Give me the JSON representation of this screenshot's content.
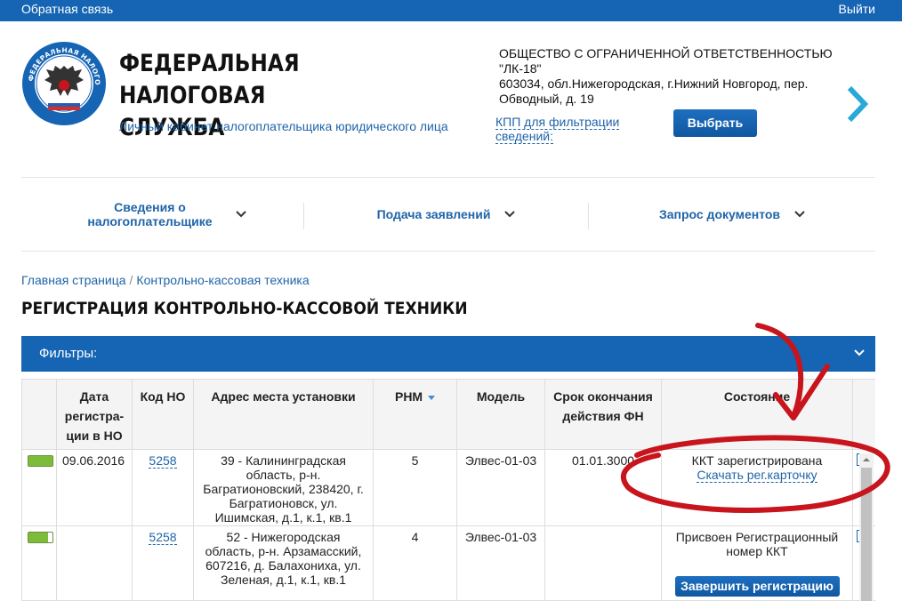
{
  "topbar": {
    "feedback": "Обратная связь",
    "logout": "Выйти"
  },
  "brand": {
    "title_lines": [
      "ФЕДЕРАЛЬНАЯ",
      "НАЛОГОВАЯ СЛУЖБА"
    ],
    "subtitle": "Личный кабинет налогоплательщика юридического лица",
    "emblem_text": "ФЕДЕРАЛЬНАЯ НАЛОГОВАЯ СЛУЖБА"
  },
  "org": {
    "lines": [
      "ОБЩЕСТВО С ОГРАНИЧЕННОЙ ОТВЕТСТВЕННОСТЬЮ",
      "\"ЛК-18\"",
      "603034, обл.Нижегородская, г.Нижний Новгород, пер.",
      "Обводный, д. 19"
    ],
    "kpp_link": "КПП для фильтрации сведений:",
    "choose_button": "Выбрать"
  },
  "nav": {
    "items": [
      {
        "label": "Сведения о налогоплательщике"
      },
      {
        "label": "Подача заявлений"
      },
      {
        "label": "Запрос документов"
      }
    ]
  },
  "breadcrumb": {
    "home": "Главная страница",
    "separator": "/",
    "current": "Контрольно-кассовая техника"
  },
  "page_title": "РЕГИСТРАЦИЯ КОНТРОЛЬНО-КАССОВОЙ ТЕХНИКИ",
  "filters": {
    "label": "Фильтры:"
  },
  "table": {
    "headers": {
      "date": "Дата регистра- ции в НО",
      "code": "Код НО",
      "address": "Адрес места установки",
      "rnm": "РНМ",
      "model": "Модель",
      "fn_expiry": "Срок окончания действия ФН",
      "status": "Состояние"
    },
    "rows": [
      {
        "progress": 1.0,
        "date": "09.06.2016",
        "code": "5258",
        "address": "39 - Калининградская область, р-н. Багратионовский, 238420, г. Багратионовск, ул. Ишимская, д.1, к.1, кв.1",
        "rnm": "5",
        "model": "Элвес-01-03",
        "fn_expiry": "01.01.3000",
        "status": "ККТ зарегистрирована",
        "status_link": "Скачать рег.карточку"
      },
      {
        "progress": 0.8,
        "date": "",
        "code": "5258",
        "address": "52 - Нижегородская область, р-н. Арзамасский, 607216, д. Балахониха, ул. Зеленая, д.1, к.1, кв.1",
        "rnm": "4",
        "model": "Элвес-01-03",
        "fn_expiry": "",
        "status": "Присвоен Регистрационный номер ККТ",
        "finish_button": "Завершить регистрацию"
      }
    ]
  },
  "colors": {
    "brand_blue": "#1565b4",
    "link_blue": "#1f64a8",
    "accent_teal": "#29a9d8",
    "status_green": "#7dbc3b",
    "annotation_red": "#c8141c"
  },
  "icons": [
    "fns-emblem-icon",
    "chevron-right-icon",
    "chevron-down-icon",
    "sort-arrow-icon"
  ]
}
